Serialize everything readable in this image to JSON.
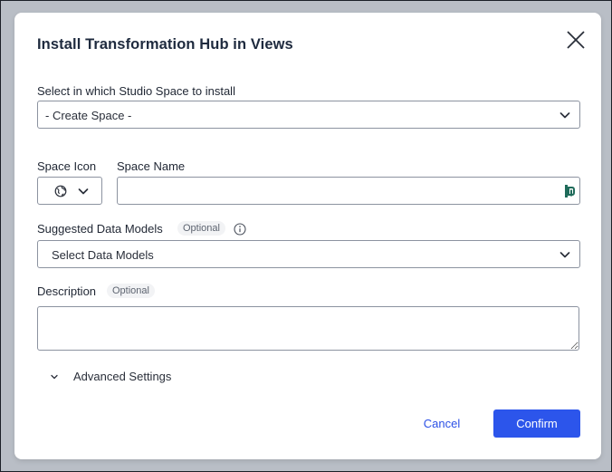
{
  "dialog": {
    "title": "Install Transformation Hub in Views",
    "close_icon": "close-icon"
  },
  "studio_space": {
    "label": "Select in which Studio Space to install",
    "value": "- Create Space -"
  },
  "space_icon": {
    "label": "Space Icon",
    "icon": "globe-icon"
  },
  "space_name": {
    "label": "Space Name",
    "value": "",
    "extension_icon": "password-manager-icon"
  },
  "data_models": {
    "label": "Suggested Data Models",
    "optional": "Optional",
    "placeholder": "Select Data Models",
    "info_icon": "info-icon"
  },
  "description": {
    "label": "Description",
    "optional": "Optional",
    "value": ""
  },
  "advanced": {
    "label": "Advanced Settings"
  },
  "footer": {
    "cancel_label": "Cancel",
    "confirm_label": "Confirm"
  },
  "colors": {
    "primary": "#2c55eb",
    "backdrop": "#b9bec6",
    "title": "#1e2a3e",
    "extension_icon": "#1f6b5a"
  }
}
